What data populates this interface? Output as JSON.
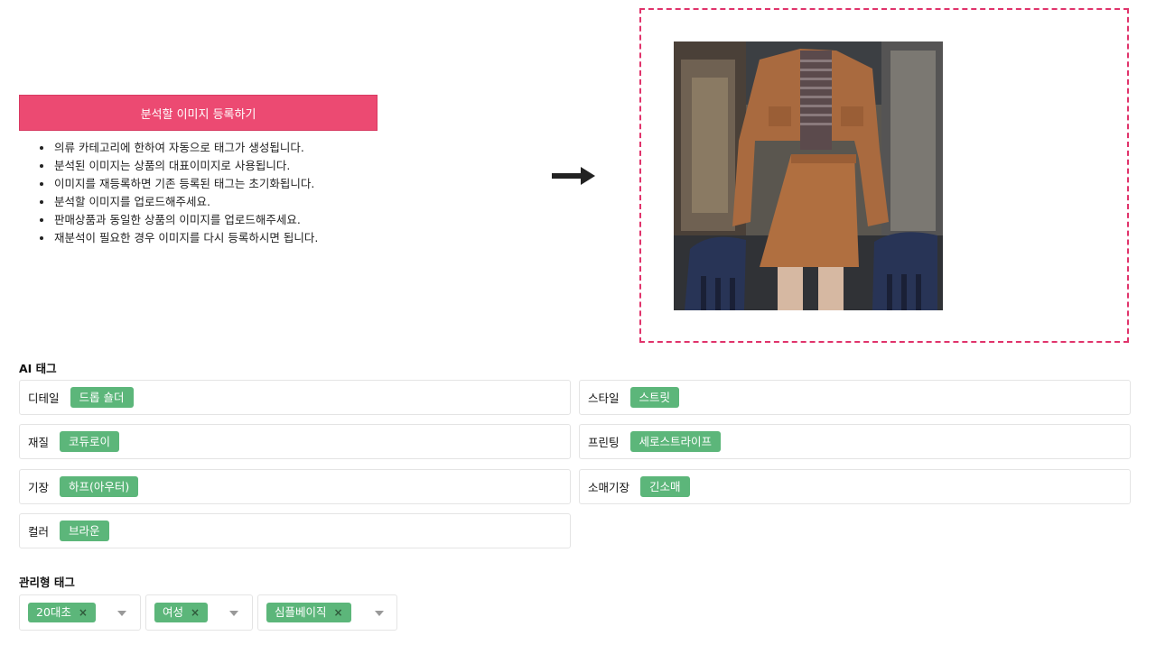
{
  "upload": {
    "button_label": "분석할 이미지 등록하기",
    "guides": [
      "의류 카테고리에 한하여 자동으로 태그가 생성됩니다.",
      "분석된 이미지는 상품의 대표이미지로 사용됩니다.",
      "이미지를 재등록하면 기존 등록된 태그는 초기화됩니다.",
      "분석할 이미지를 업로드해주세요.",
      "판매상품과 동일한 상품의 이미지를 업로드해주세요.",
      "재분석이 필요한 경우 이미지를 다시 등록하시면 됩니다."
    ]
  },
  "preview": {
    "arrow_icon": "arrow-right-icon",
    "border_color": "#e0336b"
  },
  "ai_tags": {
    "title": "AI 태그",
    "rows": [
      {
        "label": "디테일",
        "tag": "드롭 숄더"
      },
      {
        "label": "스타일",
        "tag": "스트릿"
      },
      {
        "label": "재질",
        "tag": "코듀로이"
      },
      {
        "label": "프린팅",
        "tag": "세로스트라이프"
      },
      {
        "label": "기장",
        "tag": "하프(아우터)"
      },
      {
        "label": "소매기장",
        "tag": "긴소매"
      },
      {
        "label": "컬러",
        "tag": "브라운"
      }
    ]
  },
  "managed_tags": {
    "title": "관리형 태그",
    "selects": [
      {
        "value": "20대초",
        "remove_icon": "×"
      },
      {
        "value": "여성",
        "remove_icon": "×"
      },
      {
        "value": "심플베이직",
        "remove_icon": "×"
      }
    ]
  },
  "colors": {
    "accent": "#ec4a72",
    "tag_green": "#5cb67a"
  }
}
